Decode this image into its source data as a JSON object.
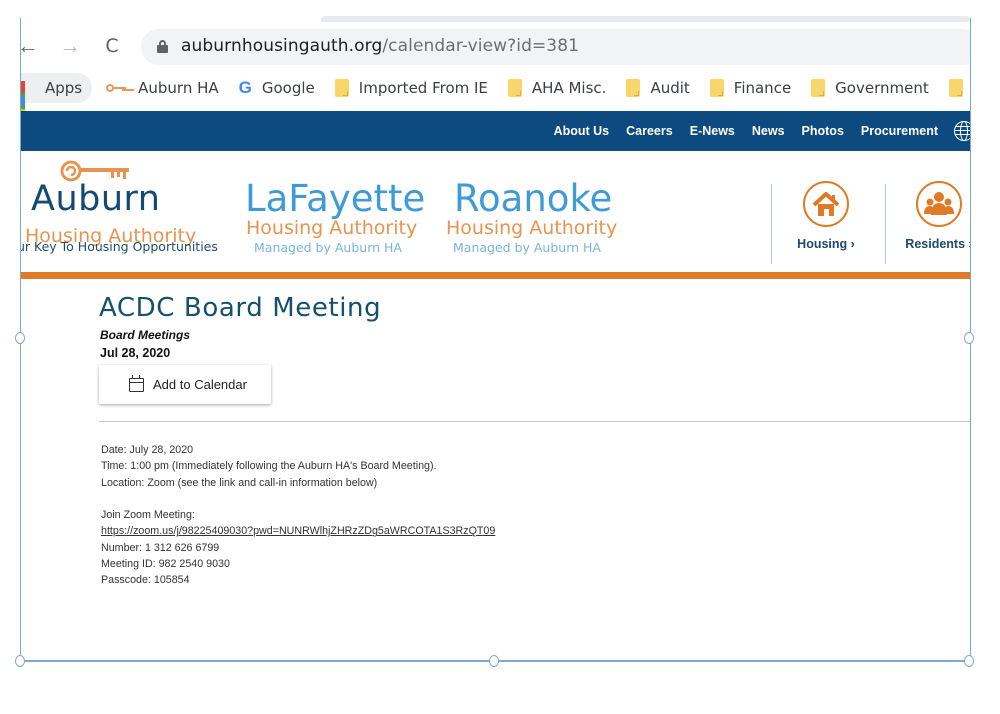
{
  "browser": {
    "nav": {
      "back": "←",
      "forward": "→",
      "reload": "C"
    },
    "url_host": "auburnhousingauth.org",
    "url_path": "/calendar-view?id=381",
    "bookmarks": [
      {
        "label": "Apps",
        "icon": "apps-grid-icon"
      },
      {
        "label": "Auburn HA",
        "icon": "key-icon"
      },
      {
        "label": "Google",
        "icon": "google-icon"
      },
      {
        "label": "Imported From IE",
        "icon": "folder-icon"
      },
      {
        "label": "AHA Misc.",
        "icon": "folder-icon"
      },
      {
        "label": "Audit",
        "icon": "folder-icon"
      },
      {
        "label": "Finance",
        "icon": "folder-icon"
      },
      {
        "label": "Government",
        "icon": "folder-icon"
      }
    ]
  },
  "site": {
    "topnav": [
      "About Us",
      "Careers",
      "E-News",
      "News",
      "Photos",
      "Procurement"
    ],
    "colors": {
      "navy": "#0d4a80",
      "orange": "#e07a26",
      "light_blue": "#3f9ad8"
    },
    "logos": {
      "auburn": {
        "name": "Auburn",
        "sub": "Housing Authority",
        "tagline": "ur Key To Housing Opportunities"
      },
      "lafayette": {
        "name": "LaFayette",
        "sub": "Housing Authority",
        "managed": "Managed by Auburn HA"
      },
      "roanoke": {
        "name": "Roanoke",
        "sub": "Housing Authority",
        "managed": "Managed by Auburn HA"
      }
    },
    "quick_links": [
      {
        "label": "Housing ›",
        "icon": "house-icon"
      },
      {
        "label": "Residents ›",
        "icon": "residents-icon"
      }
    ]
  },
  "event": {
    "title": "ACDC Board Meeting",
    "category": "Board Meetings",
    "date": "Jul 28, 2020",
    "add_to_calendar": "Add to Calendar",
    "details": {
      "date_line": "Date: July 28, 2020",
      "time_line": "Time: 1:00 pm (Immediately following the Auburn HA's Board Meeting).",
      "location_line": "Location: Zoom (see the link and call-in information below)",
      "join_label": "Join Zoom Meeting:",
      "zoom_link": "https://zoom.us/j/98225409030?pwd=NUNRWlhjZHRzZDg5aWRCOTA1S3RzQT09",
      "number_line": "Number: 1 312 626 6799",
      "meeting_id_line": "Meeting ID: 982 2540 9030",
      "passcode_line": "Passcode: 105854"
    }
  }
}
